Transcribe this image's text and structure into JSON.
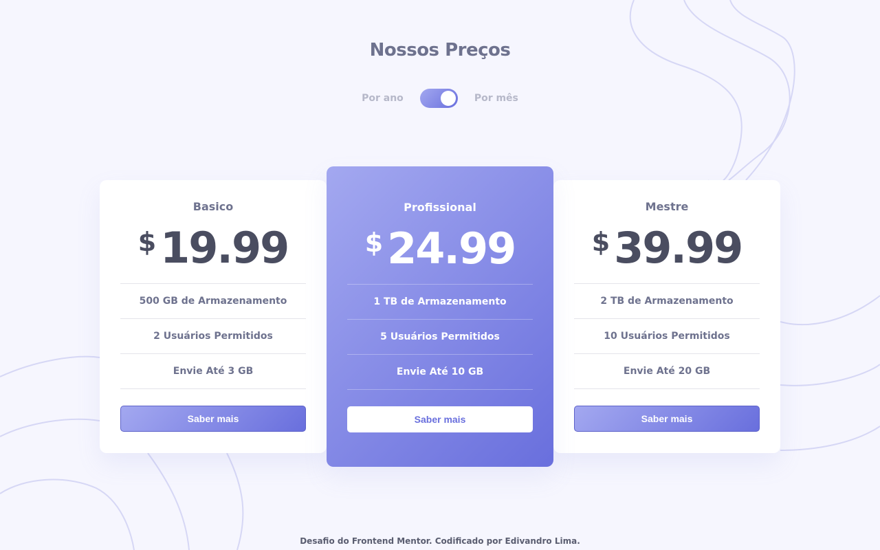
{
  "header": {
    "title": "Nossos Preços"
  },
  "billing_toggle": {
    "left_label": "Por ano",
    "right_label": "Por mês"
  },
  "plans": [
    {
      "name": "Basico",
      "currency": "$",
      "price": "19.99",
      "features": [
        "500 GB de Armazenamento",
        "2 Usuários Permitidos",
        "Envie Até 3 GB"
      ],
      "button_label": "Saber mais"
    },
    {
      "name": "Profissional",
      "currency": "$",
      "price": "24.99",
      "features": [
        "1 TB de Armazenamento",
        "5 Usuários Permitidos",
        "Envie Até 10 GB"
      ],
      "button_label": "Saber mais"
    },
    {
      "name": "Mestre",
      "currency": "$",
      "price": "39.99",
      "features": [
        "2 TB de Armazenamento",
        "10 Usuários Permitidos",
        "Envie Até 20 GB"
      ],
      "button_label": "Saber mais"
    }
  ],
  "footer": {
    "text": "Desafio do Frontend Mentor. Codificado por Edivandro Lima."
  },
  "colors": {
    "background": "#f6f6fe",
    "gradient_start": "#a3a8f0",
    "gradient_end": "#696fdd",
    "text_primary": "#6e728e",
    "price_text": "#4a4d60"
  }
}
